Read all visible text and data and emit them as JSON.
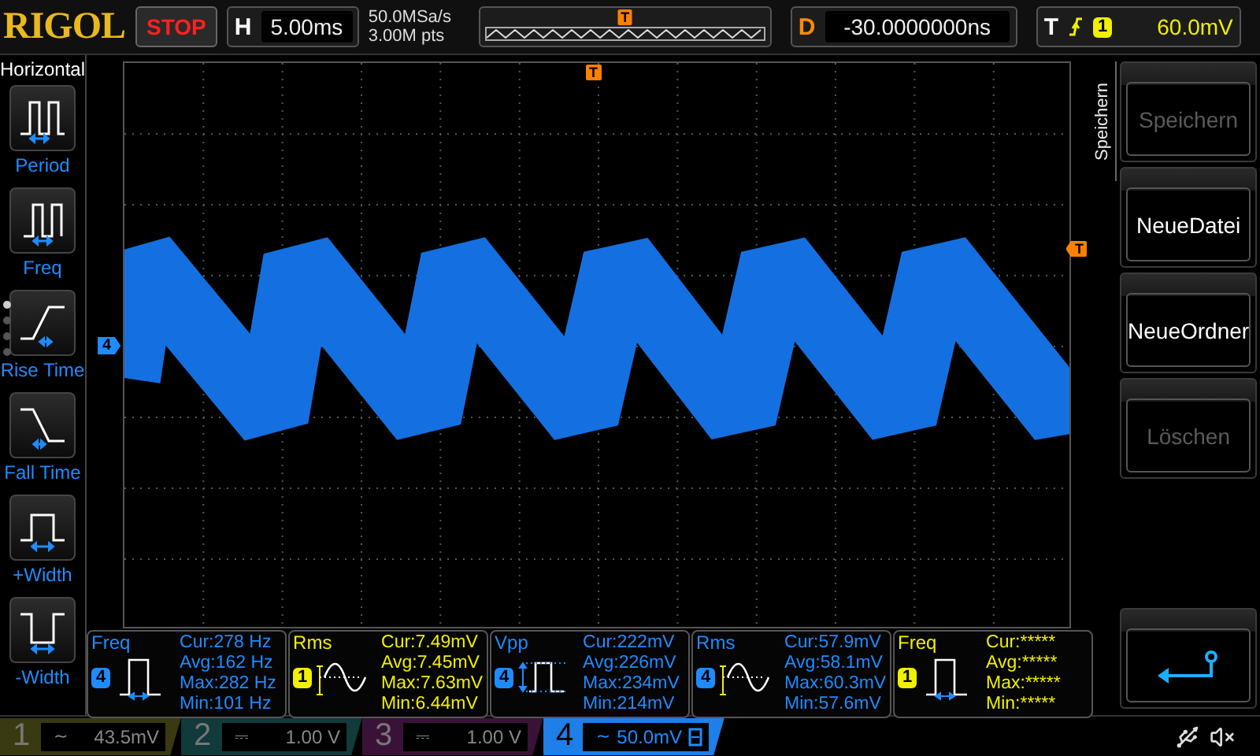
{
  "brand": "RIGOL",
  "run_state": "STOP",
  "timebase": {
    "label": "H",
    "value": "5.00ms"
  },
  "acquisition": {
    "sample_rate": "50.0MSa/s",
    "memory_depth": "3.00M pts"
  },
  "overview": {
    "trigger_marker": "T"
  },
  "delay": {
    "label": "D",
    "value": "-30.0000000ns"
  },
  "trigger": {
    "label": "T",
    "source": "1",
    "value": "60.0mV",
    "color": "#f0f000"
  },
  "left_menu": {
    "title": "Horizontal",
    "pages": [
      {
        "selected": true
      },
      {
        "selected": false
      },
      {
        "selected": false
      },
      {
        "selected": false
      }
    ],
    "items": [
      {
        "kind": "period",
        "label": "Period"
      },
      {
        "kind": "freq",
        "label": "Freq"
      },
      {
        "kind": "rise",
        "label": "Rise Time"
      },
      {
        "kind": "fall",
        "label": "Fall Time"
      },
      {
        "kind": "pwidth",
        "label": "+Width"
      },
      {
        "kind": "nwidth",
        "label": "-Width"
      }
    ]
  },
  "display": {
    "channel_marker": "4",
    "trigger_marker_top": "T",
    "trigger_marker_right": "T"
  },
  "measurements": [
    {
      "name": "Freq",
      "kind": "freq",
      "channel": "4",
      "color": "#1e8cff",
      "cur": "Cur:278 Hz",
      "avg": "Avg:162 Hz",
      "max": "Max:282 Hz",
      "min": "Min:101 Hz"
    },
    {
      "name": "Rms",
      "kind": "rms",
      "channel": "1",
      "color": "#f0f000",
      "cur": "Cur:7.49mV",
      "avg": "Avg:7.45mV",
      "max": "Max:7.63mV",
      "min": "Min:6.44mV"
    },
    {
      "name": "Vpp",
      "kind": "vpp",
      "channel": "4",
      "color": "#1e8cff",
      "cur": "Cur:222mV",
      "avg": "Avg:226mV",
      "max": "Max:234mV",
      "min": "Min:214mV"
    },
    {
      "name": "Rms",
      "kind": "rms",
      "channel": "4",
      "color": "#1e8cff",
      "cur": "Cur:57.9mV",
      "avg": "Avg:58.1mV",
      "max": "Max:60.3mV",
      "min": "Min:57.6mV"
    },
    {
      "name": "Freq",
      "kind": "freq",
      "channel": "1",
      "color": "#f0f000",
      "cur": "Cur:*****",
      "avg": "Avg:*****",
      "max": "Max:*****",
      "min": "Min:*****"
    }
  ],
  "side_menu": {
    "title": "Speichern",
    "items": [
      {
        "kind": "text",
        "label": "Speichern",
        "disabled": true
      },
      {
        "kind": "text",
        "label": "NeueDatei",
        "disabled": false
      },
      {
        "kind": "text",
        "label": "NeueOrdner",
        "disabled": false
      },
      {
        "kind": "text",
        "label": "Löschen",
        "disabled": true
      },
      {
        "kind": "return"
      }
    ]
  },
  "channels": [
    {
      "number": "1",
      "coupling": "~",
      "value": "43.5mV",
      "active": false,
      "color": "#3a3a12"
    },
    {
      "number": "2",
      "coupling": "⎓",
      "value": "1.00 V",
      "active": false,
      "color": "#113a3a"
    },
    {
      "number": "3",
      "coupling": "⎓",
      "value": "1.00 V",
      "active": false,
      "color": "#3a1238"
    },
    {
      "number": "4",
      "coupling": "~",
      "value": "50.0mV",
      "active": true,
      "color": "#1e7fe8",
      "bandwidth_limit": true
    }
  ]
}
